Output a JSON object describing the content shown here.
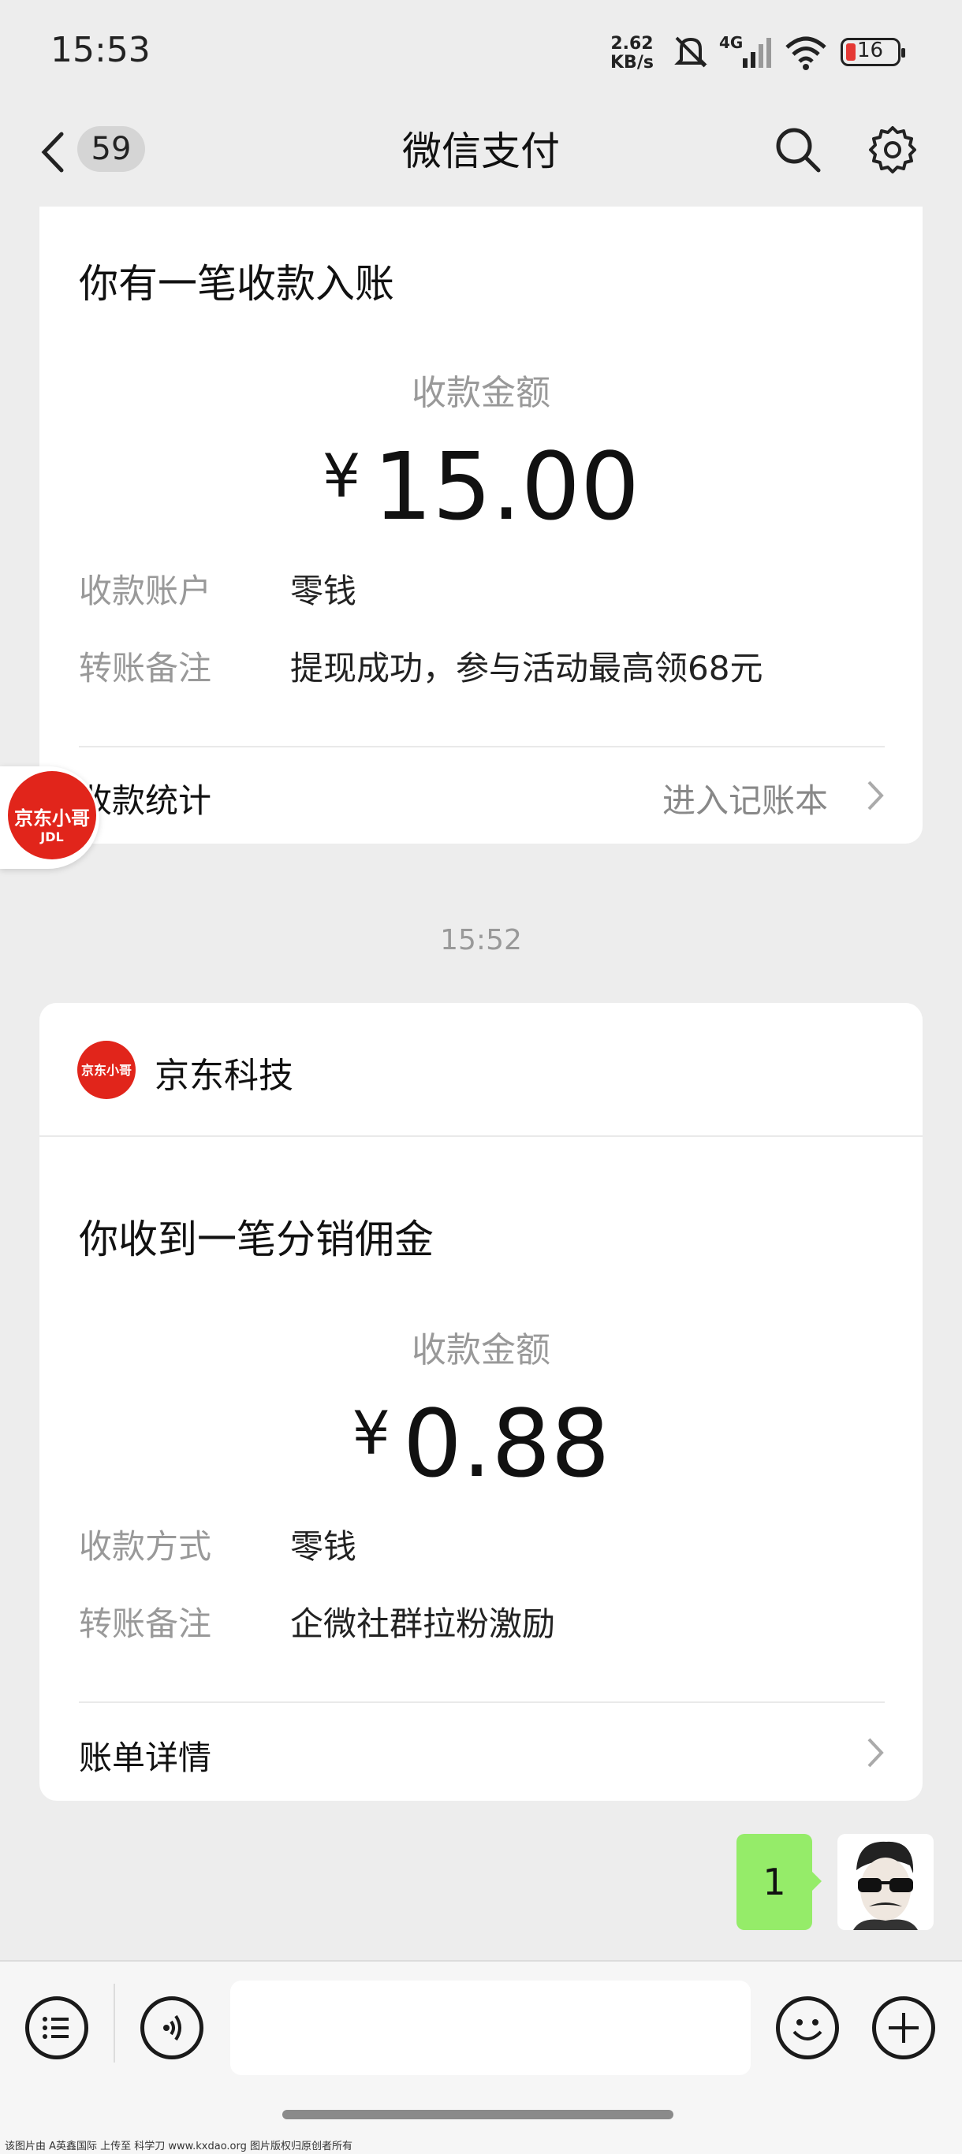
{
  "status_bar": {
    "time": "15:53",
    "net_speed_value": "2.62",
    "net_speed_unit": "KB/s",
    "network": "4G",
    "battery": "16",
    "icons": [
      "mute-icon",
      "signal-icon",
      "wifi-icon",
      "battery-icon"
    ]
  },
  "header": {
    "unread_count": "59",
    "title": "微信支付",
    "icons": [
      "back-arrow-icon",
      "search-icon",
      "gear-icon"
    ]
  },
  "messages": [
    {
      "card_title": "你有一笔收款入账",
      "amount_label": "收款金额",
      "currency": "¥",
      "amount": "15.00",
      "details": [
        {
          "label": "收款账户",
          "value": "零钱"
        },
        {
          "label": "转账备注",
          "value": "提现成功，参与活动最高领68元"
        }
      ],
      "footer_left": "收款统计",
      "footer_right": "进入记账本"
    },
    {
      "timestamp": "15:52",
      "sender": "京东科技",
      "sender_logo_text": "京东小哥",
      "card_title": "你收到一笔分销佣金",
      "amount_label": "收款金额",
      "currency": "¥",
      "amount": "0.88",
      "details": [
        {
          "label": "收款方式",
          "value": "零钱"
        },
        {
          "label": "转账备注",
          "value": "企微社群拉粉激励"
        }
      ],
      "footer_left": "账单详情"
    }
  ],
  "floating_badge": {
    "text": "京东小哥",
    "subtext": "JDL"
  },
  "outgoing_message": {
    "text": "1",
    "bubble_color": "#95ec69"
  },
  "toolbar": {
    "icons": [
      "menu-icon",
      "voice-icon",
      "emoji-icon",
      "plus-icon"
    ]
  },
  "footer_note": "该图片由 A英鑫国际 上传至 科学刀 www.kxdao.org 图片版权归原创者所有"
}
